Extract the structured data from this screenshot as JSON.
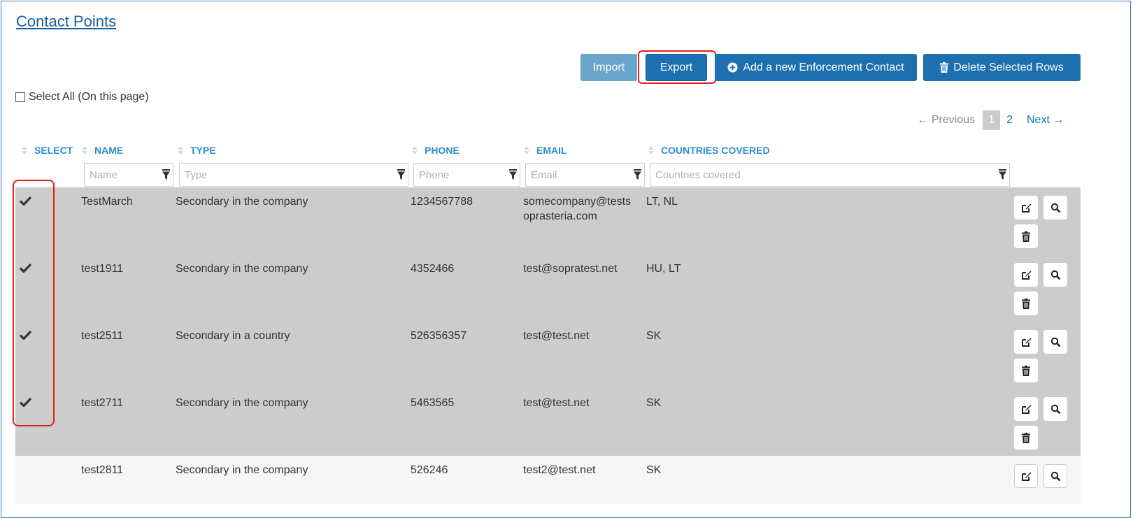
{
  "page_title": "Contact Points",
  "toolbar": {
    "import_label": "Import",
    "export_label": "Export",
    "add_label": "Add a new Enforcement Contact",
    "delete_label": "Delete Selected Rows"
  },
  "select_all_label": "Select All (On this page)",
  "pagination": {
    "previous": "← Previous",
    "current": "1",
    "page2": "2",
    "next": "Next →"
  },
  "columns": {
    "select": "SELECT",
    "name": "NAME",
    "type": "TYPE",
    "phone": "PHONE",
    "email": "EMAIL",
    "countries": "COUNTRIES COVERED"
  },
  "filters": {
    "name": "Name",
    "type": "Type",
    "phone": "Phone",
    "email": "Email",
    "countries": "Countries covered"
  },
  "rows": [
    {
      "selected": true,
      "name": "TestMarch",
      "type": "Secondary in the company",
      "phone": "1234567788",
      "email_line1": "somecompany@tests",
      "email_line2": "oprasteria.com",
      "countries": "LT, NL"
    },
    {
      "selected": true,
      "name": "test1911",
      "type": "Secondary in the company",
      "phone": "4352466",
      "email_line1": "test@sopratest.net",
      "email_line2": "",
      "countries": "HU, LT"
    },
    {
      "selected": true,
      "name": "test2511",
      "type": "Secondary in a country",
      "phone": "526356357",
      "email_line1": "test@test.net",
      "email_line2": "",
      "countries": "SK"
    },
    {
      "selected": true,
      "name": "test2711",
      "type": "Secondary in the company",
      "phone": "5463565",
      "email_line1": "test@test.net",
      "email_line2": "",
      "countries": "SK"
    },
    {
      "selected": false,
      "name": "test2811",
      "type": "Secondary in the company",
      "phone": "526246",
      "email_line1": "test2@test.net",
      "email_line2": "",
      "countries": "SK"
    }
  ],
  "colors": {
    "primary": "#1d6fb0",
    "import": "#6aa5cc",
    "header_text": "#2b8fd0",
    "selected_row": "#cccccc",
    "highlight": "#e0201b"
  }
}
